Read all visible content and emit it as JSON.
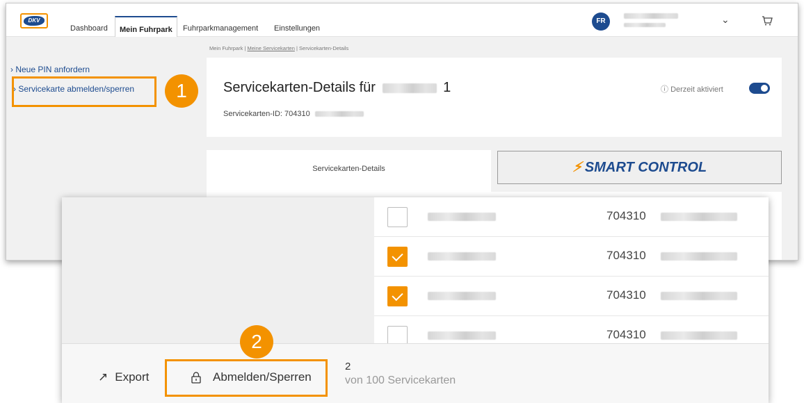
{
  "logo": "DKV",
  "nav": {
    "items": [
      "Dashboard",
      "Mein Fuhrpark",
      "Fuhrparkmanagement",
      "Einstellungen"
    ],
    "active": "Mein Fuhrpark"
  },
  "user": {
    "initials": "FR"
  },
  "sidebar": {
    "items": [
      "Neue PIN anfordern",
      "Servicekarte abmelden/sperren"
    ]
  },
  "breadcrumb": {
    "root": "Mein Fuhrpark",
    "middle": "Meine Servicekarten",
    "current": "Servicekarten-Details",
    "sep": "|"
  },
  "details": {
    "title": "Servicekarten-Details für",
    "title_suffix": "1",
    "id_label": "Servicekarten-ID: 704310",
    "status": "Derzeit aktiviert",
    "status_icon": "info-icon"
  },
  "tabs": {
    "details": "Servicekarten-Details",
    "smart": "SMART CONTROL"
  },
  "steps": {
    "one": "1",
    "two": "2"
  },
  "cards": {
    "rows": [
      {
        "checked": false,
        "prefix": "704310"
      },
      {
        "checked": true,
        "prefix": "704310"
      },
      {
        "checked": true,
        "prefix": "704310"
      },
      {
        "checked": false,
        "prefix": "704310"
      }
    ]
  },
  "footer": {
    "export_label": "Export",
    "export_icon": "export-arrow-icon",
    "block_label": "Abmelden/Sperren",
    "block_icon": "lock-icon",
    "selected_count": "2",
    "selected_of": "von 100 Servicekarten"
  },
  "colors": {
    "accent": "#f39200",
    "brand": "#1d4b8f"
  }
}
